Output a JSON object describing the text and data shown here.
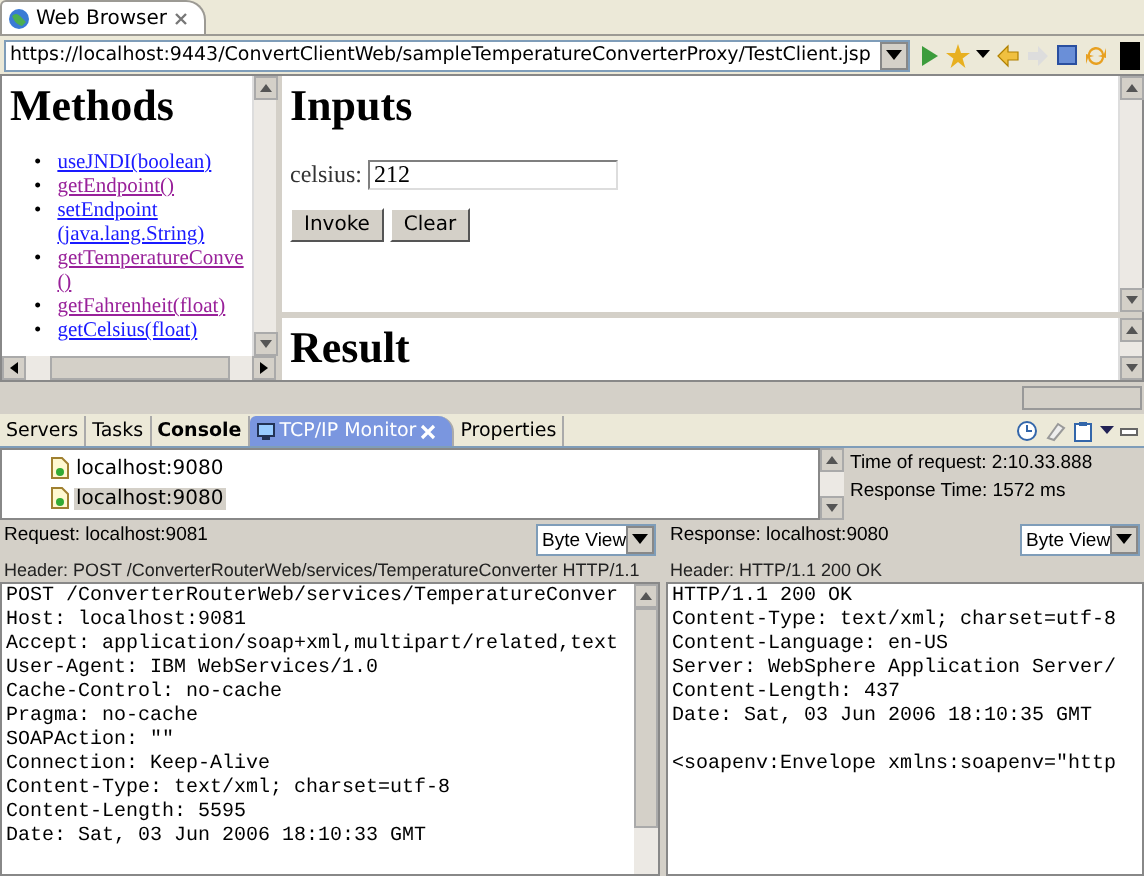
{
  "browser_tab": {
    "title": "Web Browser",
    "selected": true
  },
  "url_bar": {
    "value": "https://localhost:9443/ConvertClientWeb/sampleTemperatureConverterProxy/TestClient.jsp"
  },
  "methods": {
    "title": "Methods",
    "items": [
      {
        "marker": "•",
        "label": "useJNDI(boolean)",
        "visited": false
      },
      {
        "marker": "•",
        "label": "getEndpoint()",
        "visited": true
      },
      {
        "marker": "•",
        "label": "setEndpoint",
        "args": "(java.lang.String)",
        "visited": false
      },
      {
        "marker": "•",
        "label": "getTemperatureConve",
        "args": "()",
        "visited": true
      },
      {
        "marker": "•",
        "label": "getFahrenheit(float)",
        "visited": true
      },
      {
        "marker": "•",
        "label": "getCelsius(float)",
        "visited": false
      }
    ]
  },
  "inputs": {
    "title": "Inputs",
    "field_label": "celsius:",
    "field_value": "212",
    "buttons": [
      "Invoke",
      "Clear"
    ]
  },
  "result": {
    "title": "Result"
  },
  "view_tabs": [
    {
      "label": "Servers",
      "selected": false,
      "highlighted": false
    },
    {
      "label": "Tasks",
      "selected": false,
      "highlighted": false
    },
    {
      "label": "Console",
      "selected": false,
      "highlighted": true
    },
    {
      "label": "TCP/IP Monitor",
      "selected": true,
      "highlighted": false
    },
    {
      "label": "Properties",
      "selected": false,
      "highlighted": false
    }
  ],
  "monitor": {
    "connections": [
      {
        "label": "localhost:9080",
        "selected": false
      },
      {
        "label": "localhost:9080",
        "selected": true
      }
    ],
    "details": [
      "Time of request: 2:10.33.888",
      "Response Time: 1572 ms"
    ],
    "panes": [
      {
        "title": "Request: localhost:9081",
        "view": "Byte View",
        "header": "Header: POST /ConverterRouterWeb/services/TemperatureConverter HTTP/1.1",
        "scrollbar": true,
        "lines": [
          "POST /ConverterRouterWeb/services/TemperatureConver",
          "Host: localhost:9081",
          "Accept: application/soap+xml,multipart/related,text",
          "User-Agent: IBM WebServices/1.0",
          "Cache-Control: no-cache",
          "Pragma: no-cache",
          "SOAPAction: \"\"",
          "Connection: Keep-Alive",
          "Content-Type: text/xml; charset=utf-8",
          "Content-Length: 5595",
          "Date: Sat, 03 Jun 2006 18:10:33 GMT"
        ]
      },
      {
        "title": "Response: localhost:9080",
        "view": "Byte View",
        "header": "Header: HTTP/1.1 200 OK",
        "scrollbar": false,
        "lines": [
          "HTTP/1.1 200 OK",
          "Content-Type: text/xml; charset=utf-8",
          "Content-Language: en-US",
          "Server: WebSphere Application Server/",
          "Content-Length: 437",
          "Date: Sat, 03 Jun 2006 18:10:35 GMT"
        ],
        "body_lines": [
          "<soapenv:Envelope xmlns:soapenv=\"http"
        ]
      }
    ]
  }
}
